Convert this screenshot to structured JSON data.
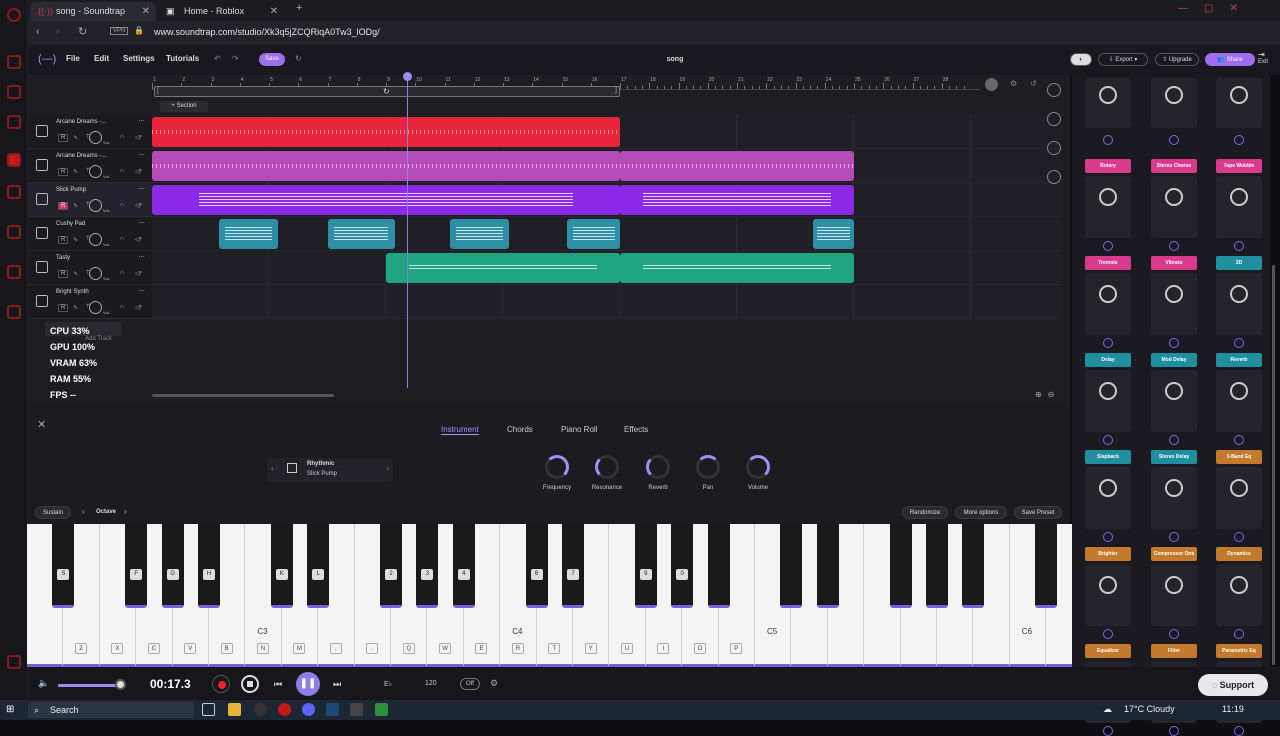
{
  "browser": {
    "tabs": [
      {
        "label": "song - Soundtrap"
      },
      {
        "label": "Home - Roblox"
      }
    ],
    "vpn": "VPN",
    "url": "www.soundtrap.com/studio/Xk3q5jZCQRiqA0Tw3_lODg/"
  },
  "header": {
    "menu": [
      "File",
      "Edit",
      "Settings",
      "Tutorials"
    ],
    "save_label": "Save",
    "song_title": "song",
    "export_label": "Export",
    "upgrade_label": "Upgrade",
    "share_label": "Share",
    "exit_label": "Exit"
  },
  "ruler": {
    "numbers": [
      "1",
      "2",
      "3",
      "4",
      "5",
      "6",
      "7",
      "8",
      "9",
      "10",
      "11",
      "12",
      "13",
      "14",
      "15",
      "16",
      "17",
      "18",
      "19",
      "20",
      "21",
      "22",
      "23",
      "24",
      "25",
      "26",
      "27",
      "28"
    ]
  },
  "section_label": "+ Section",
  "tracks": [
    {
      "name": "Arcane Dreams -...",
      "color": "#e8243b",
      "clips": [
        {
          "start": 1,
          "end": 17
        }
      ]
    },
    {
      "name": "Arcane Dreams -...",
      "color": "#b44bb8",
      "clips": [
        {
          "start": 1,
          "end": 17
        },
        {
          "start": 17,
          "end": 25
        }
      ]
    },
    {
      "name": "Slick Pump",
      "color": "#8b2ae6",
      "clips": [
        {
          "start": 1,
          "end": 17
        },
        {
          "start": 17,
          "end": 25
        }
      ]
    },
    {
      "name": "Cushy Pad",
      "color": "#2f8fa6",
      "clips": [
        {
          "start": 3.3,
          "end": 5.3
        },
        {
          "start": 7,
          "end": 9.3
        },
        {
          "start": 11.2,
          "end": 13.2
        },
        {
          "start": 15.2,
          "end": 17
        },
        {
          "start": 23.6,
          "end": 25
        }
      ]
    },
    {
      "name": "Tasty",
      "color": "#1fa57f",
      "clips": [
        {
          "start": 9,
          "end": 17
        },
        {
          "start": 17,
          "end": 25
        }
      ]
    },
    {
      "name": "Bright Synth",
      "color": "#1fa57f",
      "clips": []
    }
  ],
  "track_ctrl": {
    "r": "R",
    "vol": "VoL"
  },
  "add_track_hint": "Add Track",
  "perf": {
    "cpu": "CPU  33%",
    "gpu": "GPU 100%",
    "vram": "VRAM  63%",
    "ram": "RAM  55%",
    "fps": "FPS  --"
  },
  "instrument_panel": {
    "tabs": [
      "Instrument",
      "Chords",
      "Piano Roll",
      "Effects"
    ],
    "active_tab": "Instrument",
    "instrument_category": "Rhythmic",
    "instrument_name": "Slick Pump",
    "knobs": [
      {
        "label": "Frequency",
        "value": 0.7
      },
      {
        "label": "Resonance",
        "value": 0.2
      },
      {
        "label": "Reverb",
        "value": 0.3
      },
      {
        "label": "Pan",
        "value": 0.5
      },
      {
        "label": "Volume",
        "value": 0.75
      }
    ],
    "sustain_label": "Sustain",
    "octave_label": "Octave",
    "randomize_label": "Randomize",
    "more_options_label": "More options",
    "save_preset_label": "Save Preset"
  },
  "keyboard": {
    "white_keys": [
      "",
      "Z",
      "X",
      "C",
      "V",
      "B",
      "N",
      "M",
      ",",
      ".",
      "Q",
      "W",
      "E",
      "R",
      "T",
      "Y",
      "U",
      "I",
      "O",
      "P",
      "",
      "",
      "",
      "",
      "",
      "",
      "",
      "",
      ""
    ],
    "black_keys": [
      {
        "label": "S",
        "pos": 0
      },
      {
        "label": "F",
        "pos": 2
      },
      {
        "label": "G",
        "pos": 3
      },
      {
        "label": "H",
        "pos": 4
      },
      {
        "label": "K",
        "pos": 6
      },
      {
        "label": "L",
        "pos": 7
      },
      {
        "label": "2",
        "pos": 9
      },
      {
        "label": "3",
        "pos": 10
      },
      {
        "label": "4",
        "pos": 11
      },
      {
        "label": "6",
        "pos": 13
      },
      {
        "label": "7",
        "pos": 14
      },
      {
        "label": "9",
        "pos": 16
      },
      {
        "label": "0",
        "pos": 17
      },
      {
        "label": "",
        "pos": 18
      },
      {
        "label": "",
        "pos": 20
      },
      {
        "label": "",
        "pos": 21
      },
      {
        "label": "",
        "pos": 23
      },
      {
        "label": "",
        "pos": 24
      },
      {
        "label": "",
        "pos": 25
      },
      {
        "label": "",
        "pos": 27
      }
    ],
    "octaves": [
      "C3",
      "C4",
      "C5",
      "C6"
    ]
  },
  "transport": {
    "time": "00:17.3",
    "key": "E♭",
    "tempo": "120",
    "metronome": "Off"
  },
  "fx": {
    "rows": [
      [
        {
          "name": "",
          "color": "#d93a8c"
        },
        {
          "name": "",
          "color": "#d93a8c"
        },
        {
          "name": "",
          "color": "#d93a8c"
        }
      ],
      [
        {
          "name": "Rotary",
          "color": "#d93a8c"
        },
        {
          "name": "Stereo Chorus",
          "color": "#d93a8c"
        },
        {
          "name": "Tape Wobble",
          "color": "#d93a8c"
        }
      ],
      [
        {
          "name": "Tremolo",
          "color": "#d93a8c"
        },
        {
          "name": "Vibrato",
          "color": "#d93a8c"
        },
        {
          "name": "3D",
          "color": "#1f8fa0"
        }
      ],
      [
        {
          "name": "Delay",
          "color": "#1f8fa0"
        },
        {
          "name": "Mod Delay",
          "color": "#1f8fa0"
        },
        {
          "name": "Reverb",
          "color": "#1f8fa0"
        }
      ],
      [
        {
          "name": "Slapback",
          "color": "#1f8fa0"
        },
        {
          "name": "Stereo Delay",
          "color": "#1f8fa0"
        },
        {
          "name": "3-Band Eq",
          "color": "#c47a2c"
        }
      ],
      [
        {
          "name": "Brighter",
          "color": "#c47a2c"
        },
        {
          "name": "Compressor One",
          "color": "#c47a2c"
        },
        {
          "name": "Dynamics Compressor",
          "color": "#c47a2c"
        }
      ],
      [
        {
          "name": "Equalizer",
          "color": "#c47a2c"
        },
        {
          "name": "Filter",
          "color": "#c47a2c"
        },
        {
          "name": "Parametric Eq",
          "color": "#c47a2c"
        }
      ]
    ]
  },
  "support_label": "Support",
  "taskbar": {
    "search": "Search",
    "weather": "17°C  Cloudy",
    "time": "11:19"
  }
}
